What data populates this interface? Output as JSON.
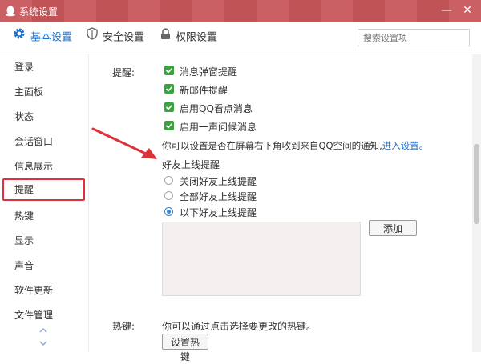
{
  "window": {
    "title": "系统设置",
    "minimize_label": "—",
    "close_label": "✕"
  },
  "tabs": [
    {
      "label": "基本设置",
      "icon": "gear-icon",
      "active": true
    },
    {
      "label": "安全设置",
      "icon": "shield-icon",
      "active": false
    },
    {
      "label": "权限设置",
      "icon": "lock-icon",
      "active": false
    }
  ],
  "search": {
    "placeholder": "搜索设置项"
  },
  "sidebar": {
    "items": [
      {
        "label": "登录"
      },
      {
        "label": "主面板"
      },
      {
        "label": "状态"
      },
      {
        "label": "会话窗口"
      },
      {
        "label": "信息展示"
      },
      {
        "label": "提醒",
        "active": true
      },
      {
        "label": "热键"
      },
      {
        "label": "显示"
      },
      {
        "label": "声音"
      },
      {
        "label": "软件更新"
      },
      {
        "label": "文件管理"
      }
    ]
  },
  "reminder": {
    "section_label": "提醒:",
    "checkboxes": [
      {
        "label": "消息弹窗提醒",
        "checked": true
      },
      {
        "label": "新邮件提醒",
        "checked": true
      },
      {
        "label": "启用QQ看点消息",
        "checked": true
      },
      {
        "label": "启用一声问候消息",
        "checked": true
      }
    ],
    "note_text": "你可以设置是否在屏幕右下角收到来自QQ空间的通知,",
    "note_link": "进入设置。",
    "friend_online_title": "好友上线提醒",
    "radios": [
      {
        "label": "关闭好友上线提醒",
        "selected": false
      },
      {
        "label": "全部好友上线提醒",
        "selected": false
      },
      {
        "label": "以下好友上线提醒",
        "selected": true
      }
    ],
    "add_button": "添加"
  },
  "hotkey": {
    "section_label": "热键:",
    "desc": "你可以通过点击选择要更改的热键。",
    "button": "设置热键"
  },
  "colors": {
    "titlebar": "#c8565a",
    "accent": "#1e6fc8",
    "checkbox": "#3aa33f",
    "highlight": "#e0303a"
  }
}
